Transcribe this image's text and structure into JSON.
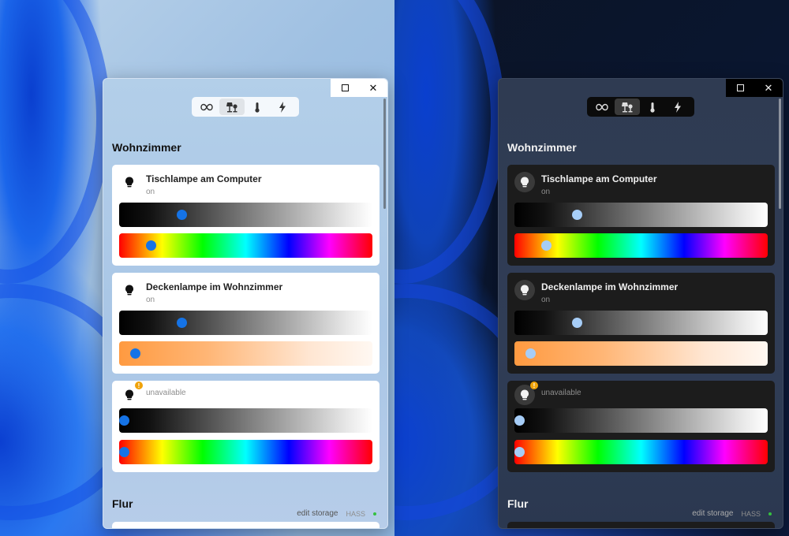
{
  "colors": {
    "accent_light": "#1573e6",
    "accent_dark": "#a6cdf7",
    "warning": "#f0a30a",
    "status_ok": "#35c040"
  },
  "themes": [
    {
      "theme": "light",
      "window": {
        "maximize_icon": "maximize-icon",
        "close_icon": "close-icon"
      },
      "tabs": [
        {
          "icon": "infinity-icon",
          "active": false
        },
        {
          "icon": "lamps-icon",
          "active": true
        },
        {
          "icon": "thermometer-icon",
          "active": false
        },
        {
          "icon": "lightning-icon",
          "active": false
        }
      ],
      "sections": [
        {
          "title": "Wohnzimmer",
          "lights": [
            {
              "name": "Tischlampe am Computer",
              "state": "on",
              "icon": "lightbulb-icon",
              "brightness": 0.25,
              "color_slider": "hue",
              "color_position": 0.13
            },
            {
              "name": "Deckenlampe im Wohnzimmer",
              "state": "on",
              "icon": "lightbulb-icon",
              "brightness": 0.25,
              "color_slider": "color-temperature",
              "color_position": 0.06
            },
            {
              "name": "",
              "state": "unavailable",
              "icon": "lightbulb-icon",
              "warning": "!",
              "brightness": 0.0,
              "color_slider": "hue",
              "color_position": 0.0
            }
          ]
        },
        {
          "title": "Flur"
        }
      ],
      "footer": {
        "edit_storage": "edit storage",
        "hass_label": "HASS"
      }
    },
    {
      "theme": "dark",
      "window": {
        "maximize_icon": "maximize-icon",
        "close_icon": "close-icon"
      },
      "tabs": [
        {
          "icon": "infinity-icon",
          "active": false
        },
        {
          "icon": "lamps-icon",
          "active": true
        },
        {
          "icon": "thermometer-icon",
          "active": false
        },
        {
          "icon": "lightning-icon",
          "active": false
        }
      ],
      "sections": [
        {
          "title": "Wohnzimmer",
          "lights": [
            {
              "name": "Tischlampe am Computer",
              "state": "on",
              "icon": "lightbulb-icon",
              "brightness": 0.25,
              "color_slider": "hue",
              "color_position": 0.13
            },
            {
              "name": "Deckenlampe im Wohnzimmer",
              "state": "on",
              "icon": "lightbulb-icon",
              "brightness": 0.25,
              "color_slider": "color-temperature",
              "color_position": 0.06
            },
            {
              "name": "",
              "state": "unavailable",
              "icon": "lightbulb-icon",
              "warning": "!",
              "brightness": 0.0,
              "color_slider": "hue",
              "color_position": 0.0
            }
          ]
        },
        {
          "title": "Flur"
        }
      ],
      "footer": {
        "edit_storage": "edit storage",
        "hass_label": "HASS"
      }
    }
  ]
}
